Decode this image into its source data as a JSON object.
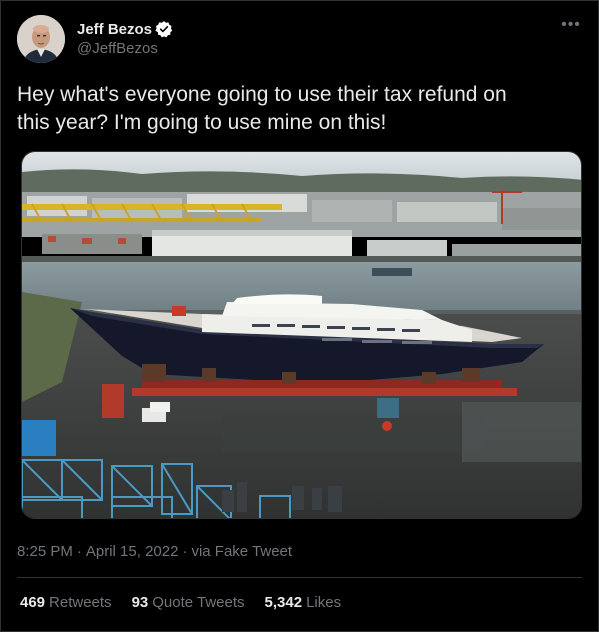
{
  "author": {
    "display_name": "Jeff Bezos",
    "handle": "@JeffBezos",
    "verified": true,
    "avatar_icon": "profile-photo"
  },
  "tweet": {
    "text": "Hey what's everyone going to use their tax refund on\nthis year? I'm going to use mine on this!"
  },
  "meta": {
    "time": "8:25 PM",
    "date": "April 15, 2022",
    "source": "via Fake Tweet"
  },
  "stats": {
    "retweets_count": "469",
    "retweets_label": "Retweets",
    "quotes_count": "93",
    "quotes_label": "Quote Tweets",
    "likes_count": "5,342",
    "likes_label": "Likes"
  },
  "colors": {
    "background": "#000000",
    "text": "#e7e9ea",
    "secondary": "#71767b",
    "border": "#2f3336",
    "verified": "#1d9bf0"
  }
}
